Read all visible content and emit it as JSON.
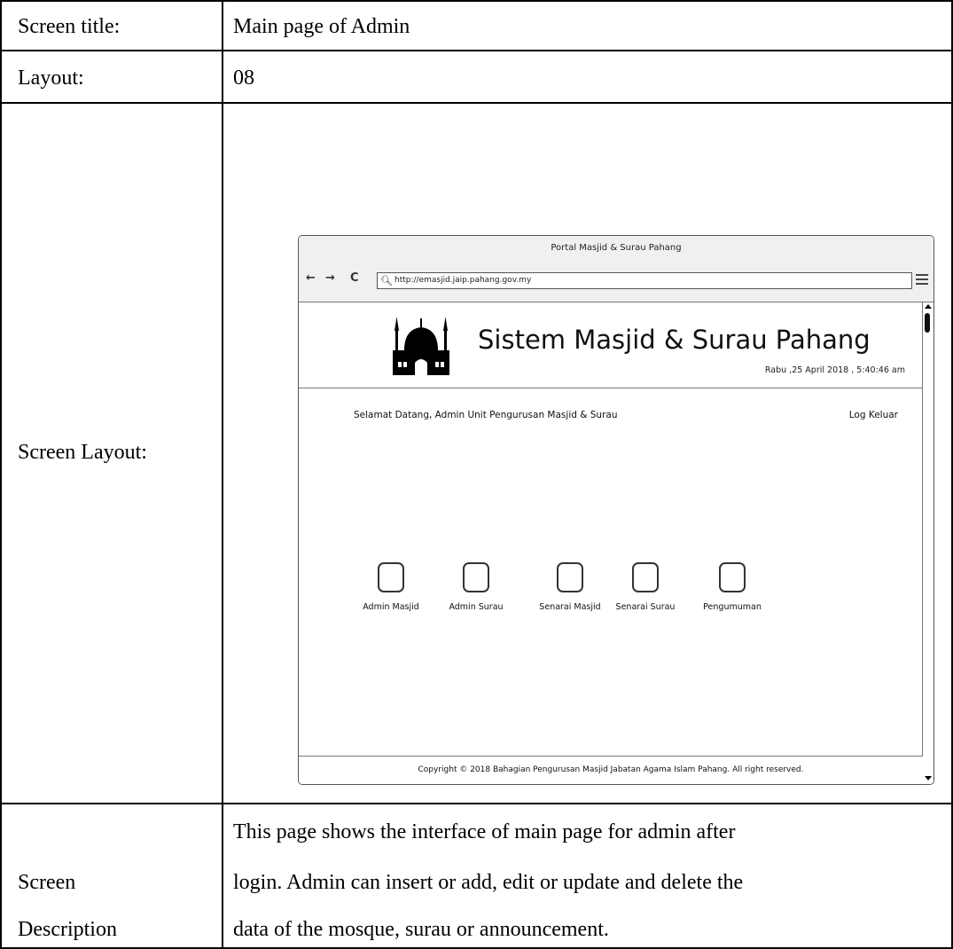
{
  "table": {
    "rows": [
      {
        "label": "Screen title:",
        "value": "Main page of Admin"
      },
      {
        "label": "Layout:",
        "value": "08"
      },
      {
        "label": "Screen Layout:"
      },
      {
        "label_lines": [
          "Screen",
          "Description"
        ],
        "value_lines": [
          "This page shows the interface of main page for admin after",
          "login. Admin can insert or add, edit or update and delete the",
          "data of the mosque, surau or announcement."
        ]
      }
    ]
  },
  "mockup": {
    "window_title": "Portal Masjid & Surau Pahang",
    "nav": {
      "back": "←",
      "forward": "→",
      "reload": "C"
    },
    "url": "http://emasjid.jaip.pahang.gov.my",
    "header": {
      "title": "Sistem Masjid & Surau Pahang",
      "datetime": "Rabu ,25 April 2018 , 5:40:46 am"
    },
    "welcome": "Selamat Datang, Admin Unit Pengurusan Masjid & Surau",
    "logout": "Log Keluar",
    "menu_items": [
      {
        "label": "Admin Masjid"
      },
      {
        "label": "Admin Surau"
      },
      {
        "label": "Senarai Masjid"
      },
      {
        "label": "Senarai Surau"
      },
      {
        "label": "Pengumuman"
      }
    ],
    "footer": "Copyright © 2018 Bahagian Pengurusan Masjid Jabatan Agama Islam Pahang. All right reserved."
  }
}
